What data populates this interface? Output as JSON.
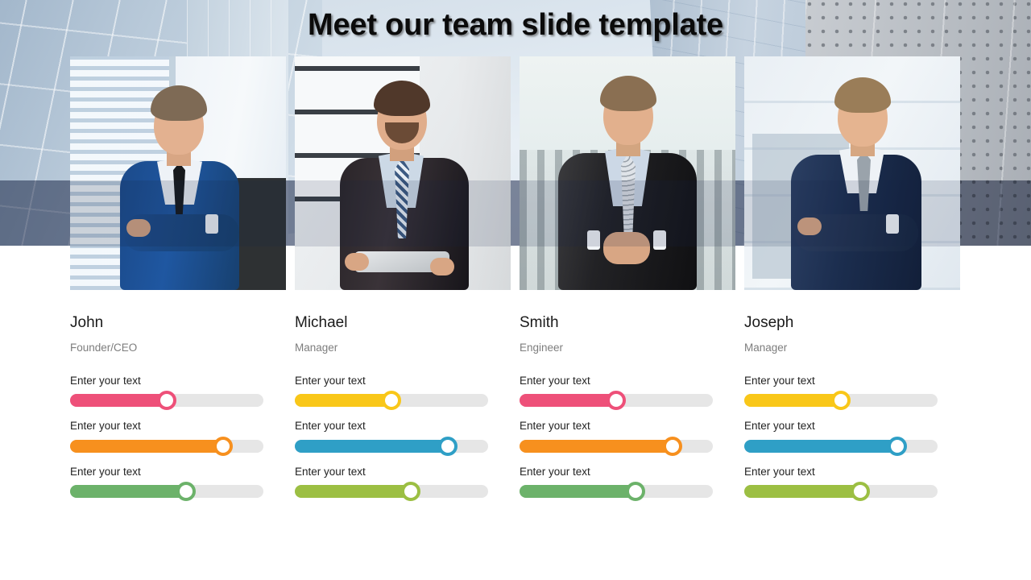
{
  "slide": {
    "title": "Meet our team slide template",
    "background": {
      "description": "modern-glass-office-buildings",
      "stripe_color": "#18264A",
      "sky_color": "#dbe5ee",
      "panel_color": "#bfc4c8"
    }
  },
  "colors": {
    "pink": "#ee5079",
    "orange": "#f7901e",
    "green": "#6cb26a",
    "yellow": "#f9c719",
    "blue": "#2f9fc6",
    "lime": "#9cbf43",
    "track": "#e6e6e6",
    "name_text": "#1a1a1a",
    "role_text": "#7d7d7d",
    "label_text": "#222222"
  },
  "members": [
    {
      "photo_alt": "man-in-blue-suit-arms-crossed",
      "name": "John",
      "role": "Founder/CEO",
      "skills": [
        {
          "label": "Enter your text",
          "percent": 50,
          "color": "#ee5079"
        },
        {
          "label": "Enter your text",
          "percent": 79,
          "color": "#f7901e"
        },
        {
          "label": "Enter your text",
          "percent": 60,
          "color": "#6cb26a"
        }
      ]
    },
    {
      "photo_alt": "bearded-man-dark-suit-holding-tablet",
      "name": "Michael",
      "role": "Manager",
      "skills": [
        {
          "label": "Enter your text",
          "percent": 50,
          "color": "#f9c719"
        },
        {
          "label": "Enter your text",
          "percent": 79,
          "color": "#2f9fc6"
        },
        {
          "label": "Enter your text",
          "percent": 60,
          "color": "#9cbf43"
        }
      ]
    },
    {
      "photo_alt": "man-dark-suit-hands-clasped-cityscape",
      "name": "Smith",
      "role": "Engineer",
      "skills": [
        {
          "label": "Enter your text",
          "percent": 50,
          "color": "#ee5079"
        },
        {
          "label": "Enter your text",
          "percent": 79,
          "color": "#f7901e"
        },
        {
          "label": "Enter your text",
          "percent": 60,
          "color": "#6cb26a"
        }
      ]
    },
    {
      "photo_alt": "man-navy-suit-arms-crossed-window",
      "name": "Joseph",
      "role": "Manager",
      "skills": [
        {
          "label": "Enter your text",
          "percent": 50,
          "color": "#f9c719"
        },
        {
          "label": "Enter your text",
          "percent": 79,
          "color": "#2f9fc6"
        },
        {
          "label": "Enter your text",
          "percent": 60,
          "color": "#9cbf43"
        }
      ]
    }
  ]
}
